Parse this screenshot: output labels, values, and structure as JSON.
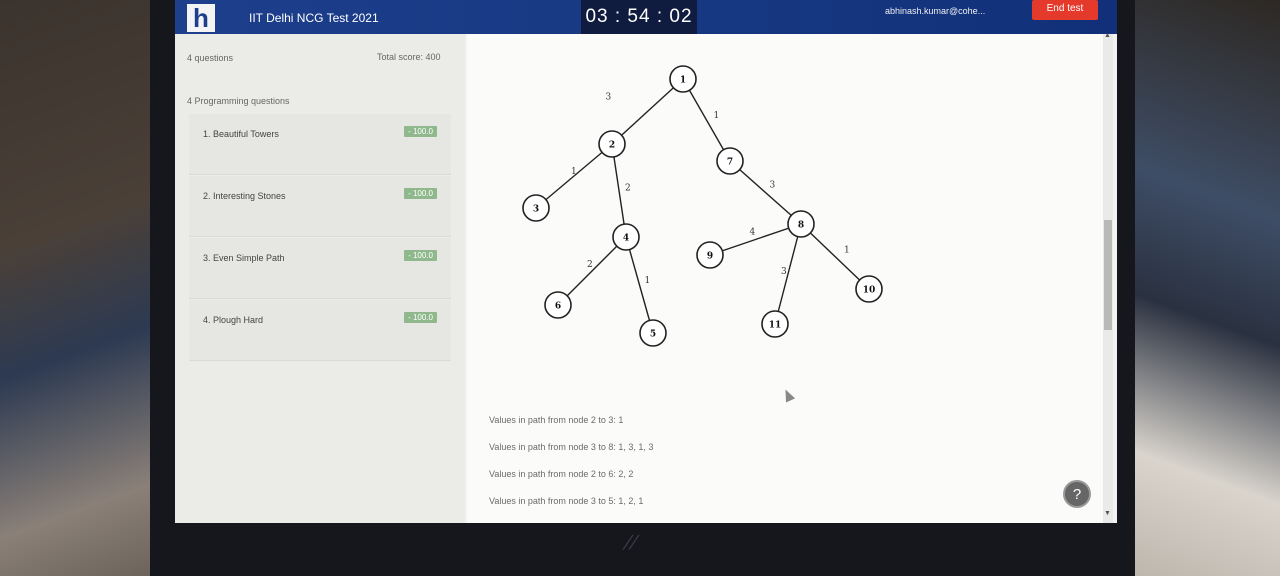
{
  "header": {
    "logo_letter": "h",
    "test_title": "IIT Delhi NCG Test 2021",
    "timer": "03 : 54 : 02",
    "user_email": "abhinash.kumar@cohe...",
    "end_test_label": "End test"
  },
  "sidebar": {
    "question_count": "4 questions",
    "total_score": "Total score: 400",
    "section_heading": "4 Programming questions",
    "questions": [
      {
        "label": "1.  Beautiful Towers",
        "score": "- 100.0"
      },
      {
        "label": "2.  Interesting Stones",
        "score": "- 100.0"
      },
      {
        "label": "3.  Even Simple Path",
        "score": "- 100.0"
      },
      {
        "label": "4.  Plough Hard",
        "score": "- 100.0"
      }
    ]
  },
  "tree": {
    "nodes": [
      "1",
      "2",
      "3",
      "4",
      "5",
      "6",
      "7",
      "8",
      "9",
      "10",
      "11"
    ],
    "edges": [
      {
        "from": "1",
        "to": "2",
        "weight": "3"
      },
      {
        "from": "1",
        "to": "7",
        "weight": "1"
      },
      {
        "from": "2",
        "to": "3",
        "weight": "1"
      },
      {
        "from": "2",
        "to": "4",
        "weight": "2"
      },
      {
        "from": "4",
        "to": "6",
        "weight": "2"
      },
      {
        "from": "4",
        "to": "5",
        "weight": "1"
      },
      {
        "from": "7",
        "to": "8",
        "weight": "3"
      },
      {
        "from": "8",
        "to": "9",
        "weight": "4"
      },
      {
        "from": "8",
        "to": "11",
        "weight": "3"
      },
      {
        "from": "8",
        "to": "10",
        "weight": "1"
      }
    ]
  },
  "content": {
    "path_lines": [
      "Values in path from node 2 to 3: 1",
      "Values in path from node 3 to 8: 1, 3, 1, 3",
      "Values in path from node 2 to 6: 2, 2",
      "Values in path from node 3 to 5: 1, 2, 1"
    ]
  },
  "help_label": "?"
}
